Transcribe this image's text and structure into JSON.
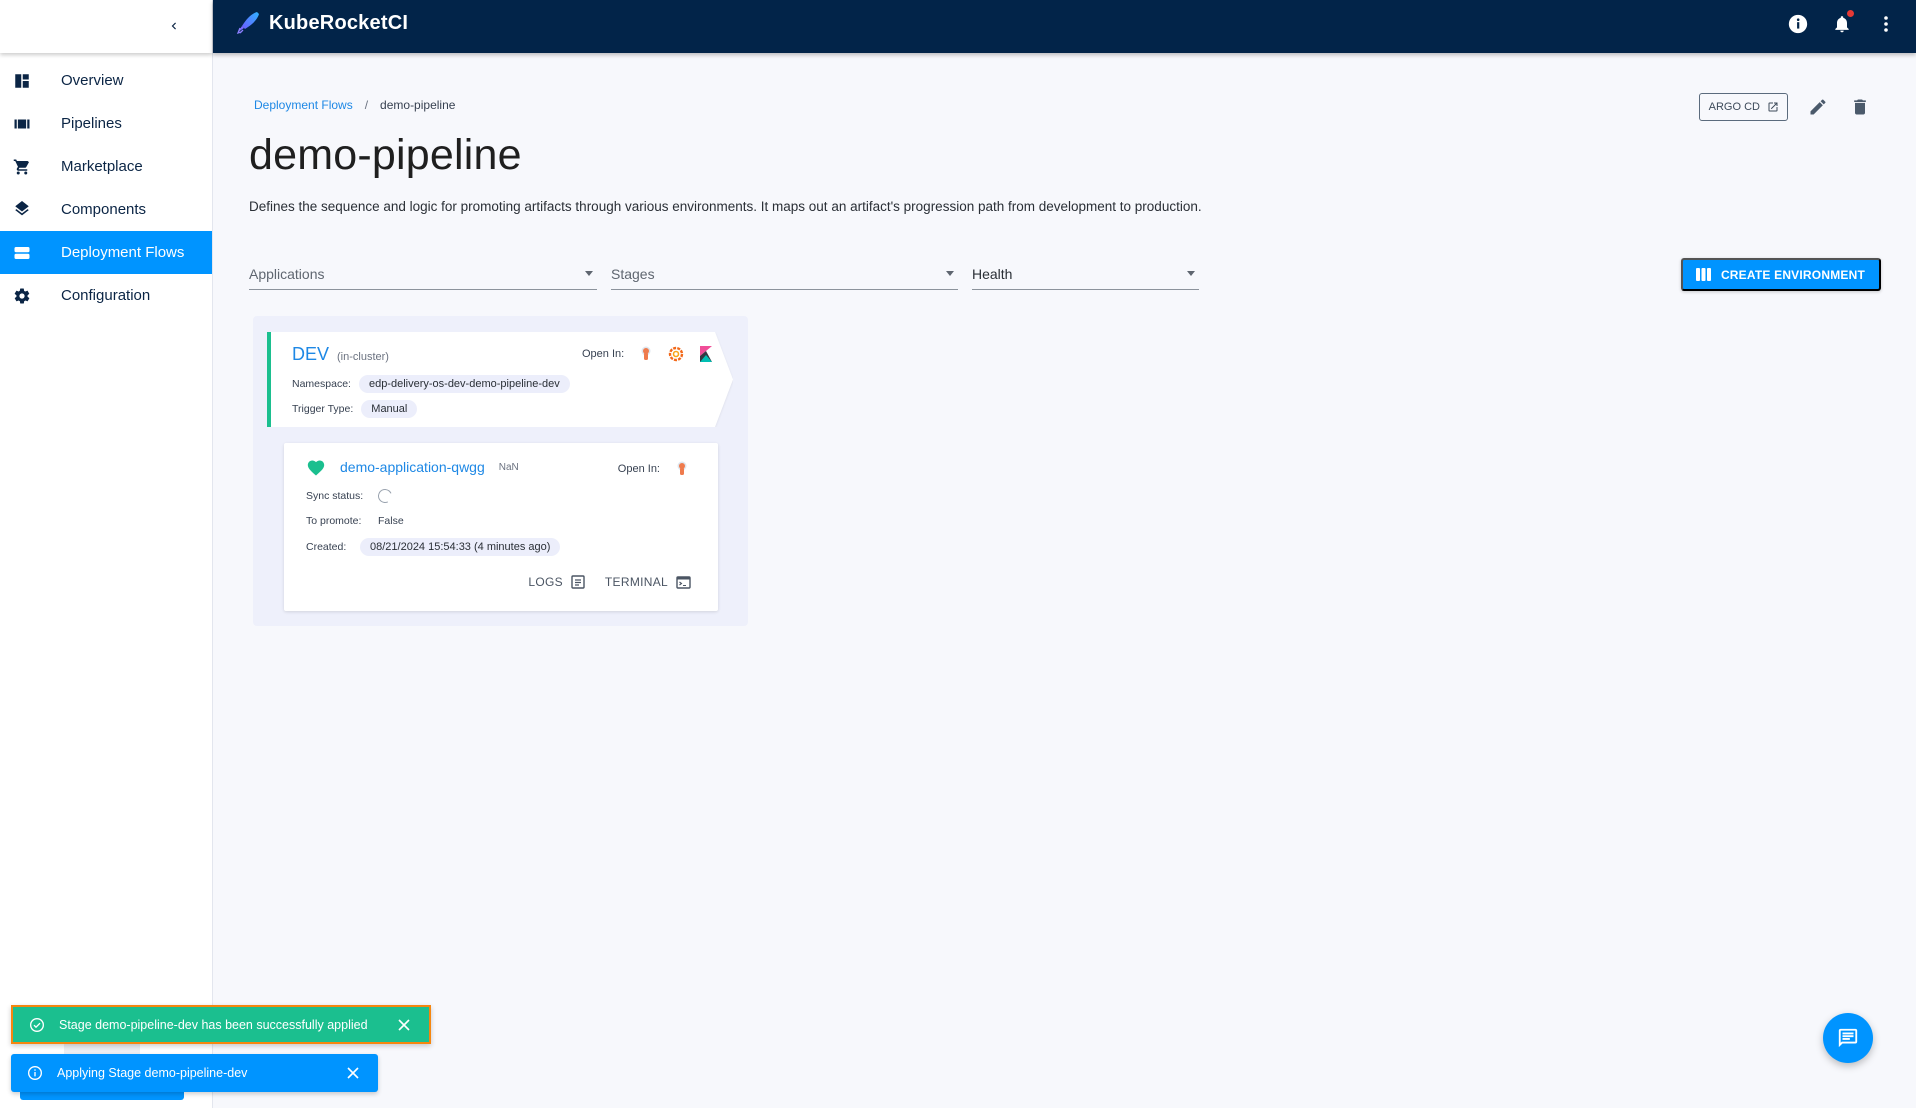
{
  "app": {
    "title": "KubeRocketCI",
    "accent_color": "#0094ff",
    "topbar_color": "#022449"
  },
  "topbar": {
    "icons": [
      "info-icon",
      "notifications-icon",
      "more-vert-icon"
    ],
    "has_unread_notifications": true
  },
  "sidebar": {
    "collapse_icon": "chevron-left-icon",
    "items": [
      {
        "label": "Overview",
        "icon": "dashboard-icon",
        "active": false
      },
      {
        "label": "Pipelines",
        "icon": "pipelines-icon",
        "active": false
      },
      {
        "label": "Marketplace",
        "icon": "cart-icon",
        "active": false
      },
      {
        "label": "Components",
        "icon": "layers-icon",
        "active": false
      },
      {
        "label": "Deployment Flows",
        "icon": "deployment-flows-icon",
        "active": true
      },
      {
        "label": "Configuration",
        "icon": "gear-icon",
        "active": false
      }
    ]
  },
  "breadcrumb": {
    "parent": "Deployment Flows",
    "separator": "/",
    "current": "demo-pipeline"
  },
  "page": {
    "title": "demo-pipeline",
    "description": "Defines the sequence and logic for promoting artifacts through various environments. It maps out an artifact's progression path from development to production."
  },
  "header_actions": {
    "argo_label": "ARGO CD",
    "edit_icon": "edit-icon",
    "delete_icon": "delete-icon"
  },
  "filters": {
    "applications": "Applications",
    "stages": "Stages",
    "health": "Health"
  },
  "create_button": {
    "label": "CREATE ENVIRONMENT"
  },
  "stage": {
    "name": "DEV",
    "cluster": "(in-cluster)",
    "open_in_label": "Open In:",
    "open_in_tools": [
      "argocd",
      "grafana",
      "kibana"
    ],
    "namespace_label": "Namespace:",
    "namespace": "edp-delivery-os-dev-demo-pipeline-dev",
    "trigger_label": "Trigger Type:",
    "trigger": "Manual",
    "status_color": "#1bbf8f"
  },
  "application": {
    "name": "demo-application-qwgg",
    "version": "NaN",
    "health": "healthy",
    "health_color": "#1bbf8f",
    "open_in_label": "Open In:",
    "open_in_tools": [
      "argocd"
    ],
    "sync_label": "Sync status:",
    "sync_status": "loading",
    "promote_label": "To promote:",
    "promote": "False",
    "created_label": "Created:",
    "created": "08/21/2024 15:54:33 (4 minutes ago)",
    "logs_label": "LOGS",
    "terminal_label": "TERMINAL"
  },
  "toasts": [
    {
      "type": "success",
      "message": "Stage demo-pipeline-dev has been successfully applied",
      "color": "#1bbf8f"
    },
    {
      "type": "info",
      "message": "Applying Stage demo-pipeline-dev",
      "color": "#0094ff"
    }
  ],
  "fab": {
    "icon": "chat-icon"
  }
}
